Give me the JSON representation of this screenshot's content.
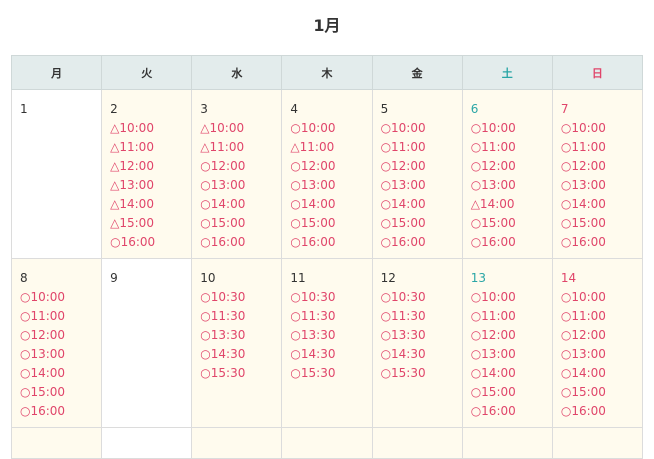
{
  "title": "1月",
  "weekdays": [
    "月",
    "火",
    "水",
    "木",
    "金",
    "土",
    "日"
  ],
  "weeks": [
    [
      {
        "day": "1",
        "slots": []
      },
      {
        "day": "2",
        "slots": [
          "△10:00",
          "△11:00",
          "△12:00",
          "△13:00",
          "△14:00",
          "△15:00",
          "○16:00"
        ]
      },
      {
        "day": "3",
        "slots": [
          "△10:00",
          "△11:00",
          "○12:00",
          "○13:00",
          "○14:00",
          "○15:00",
          "○16:00"
        ]
      },
      {
        "day": "4",
        "slots": [
          "○10:00",
          "△11:00",
          "○12:00",
          "○13:00",
          "○14:00",
          "○15:00",
          "○16:00"
        ]
      },
      {
        "day": "5",
        "slots": [
          "○10:00",
          "○11:00",
          "○12:00",
          "○13:00",
          "○14:00",
          "○15:00",
          "○16:00"
        ]
      },
      {
        "day": "6",
        "slots": [
          "○10:00",
          "○11:00",
          "○12:00",
          "○13:00",
          "△14:00",
          "○15:00",
          "○16:00"
        ]
      },
      {
        "day": "7",
        "slots": [
          "○10:00",
          "○11:00",
          "○12:00",
          "○13:00",
          "○14:00",
          "○15:00",
          "○16:00"
        ]
      }
    ],
    [
      {
        "day": "8",
        "slots": [
          "○10:00",
          "○11:00",
          "○12:00",
          "○13:00",
          "○14:00",
          "○15:00",
          "○16:00"
        ]
      },
      {
        "day": "9",
        "slots": []
      },
      {
        "day": "10",
        "slots": [
          "○10:30",
          "○11:30",
          "○13:30",
          "○14:30",
          "○15:30"
        ]
      },
      {
        "day": "11",
        "slots": [
          "○10:30",
          "○11:30",
          "○13:30",
          "○14:30",
          "○15:30"
        ]
      },
      {
        "day": "12",
        "slots": [
          "○10:30",
          "○11:30",
          "○13:30",
          "○14:30",
          "○15:30"
        ]
      },
      {
        "day": "13",
        "slots": [
          "○10:00",
          "○11:00",
          "○12:00",
          "○13:00",
          "○14:00",
          "○15:00",
          "○16:00"
        ]
      },
      {
        "day": "14",
        "slots": [
          "○10:00",
          "○11:00",
          "○12:00",
          "○13:00",
          "○14:00",
          "○15:00",
          "○16:00"
        ]
      }
    ]
  ],
  "colors": {
    "header_bg": "#e3ecec",
    "cell_bg": "#fffbee",
    "slot": "#e0456a",
    "saturday": "#2aa6a6",
    "sunday": "#e0456a"
  }
}
